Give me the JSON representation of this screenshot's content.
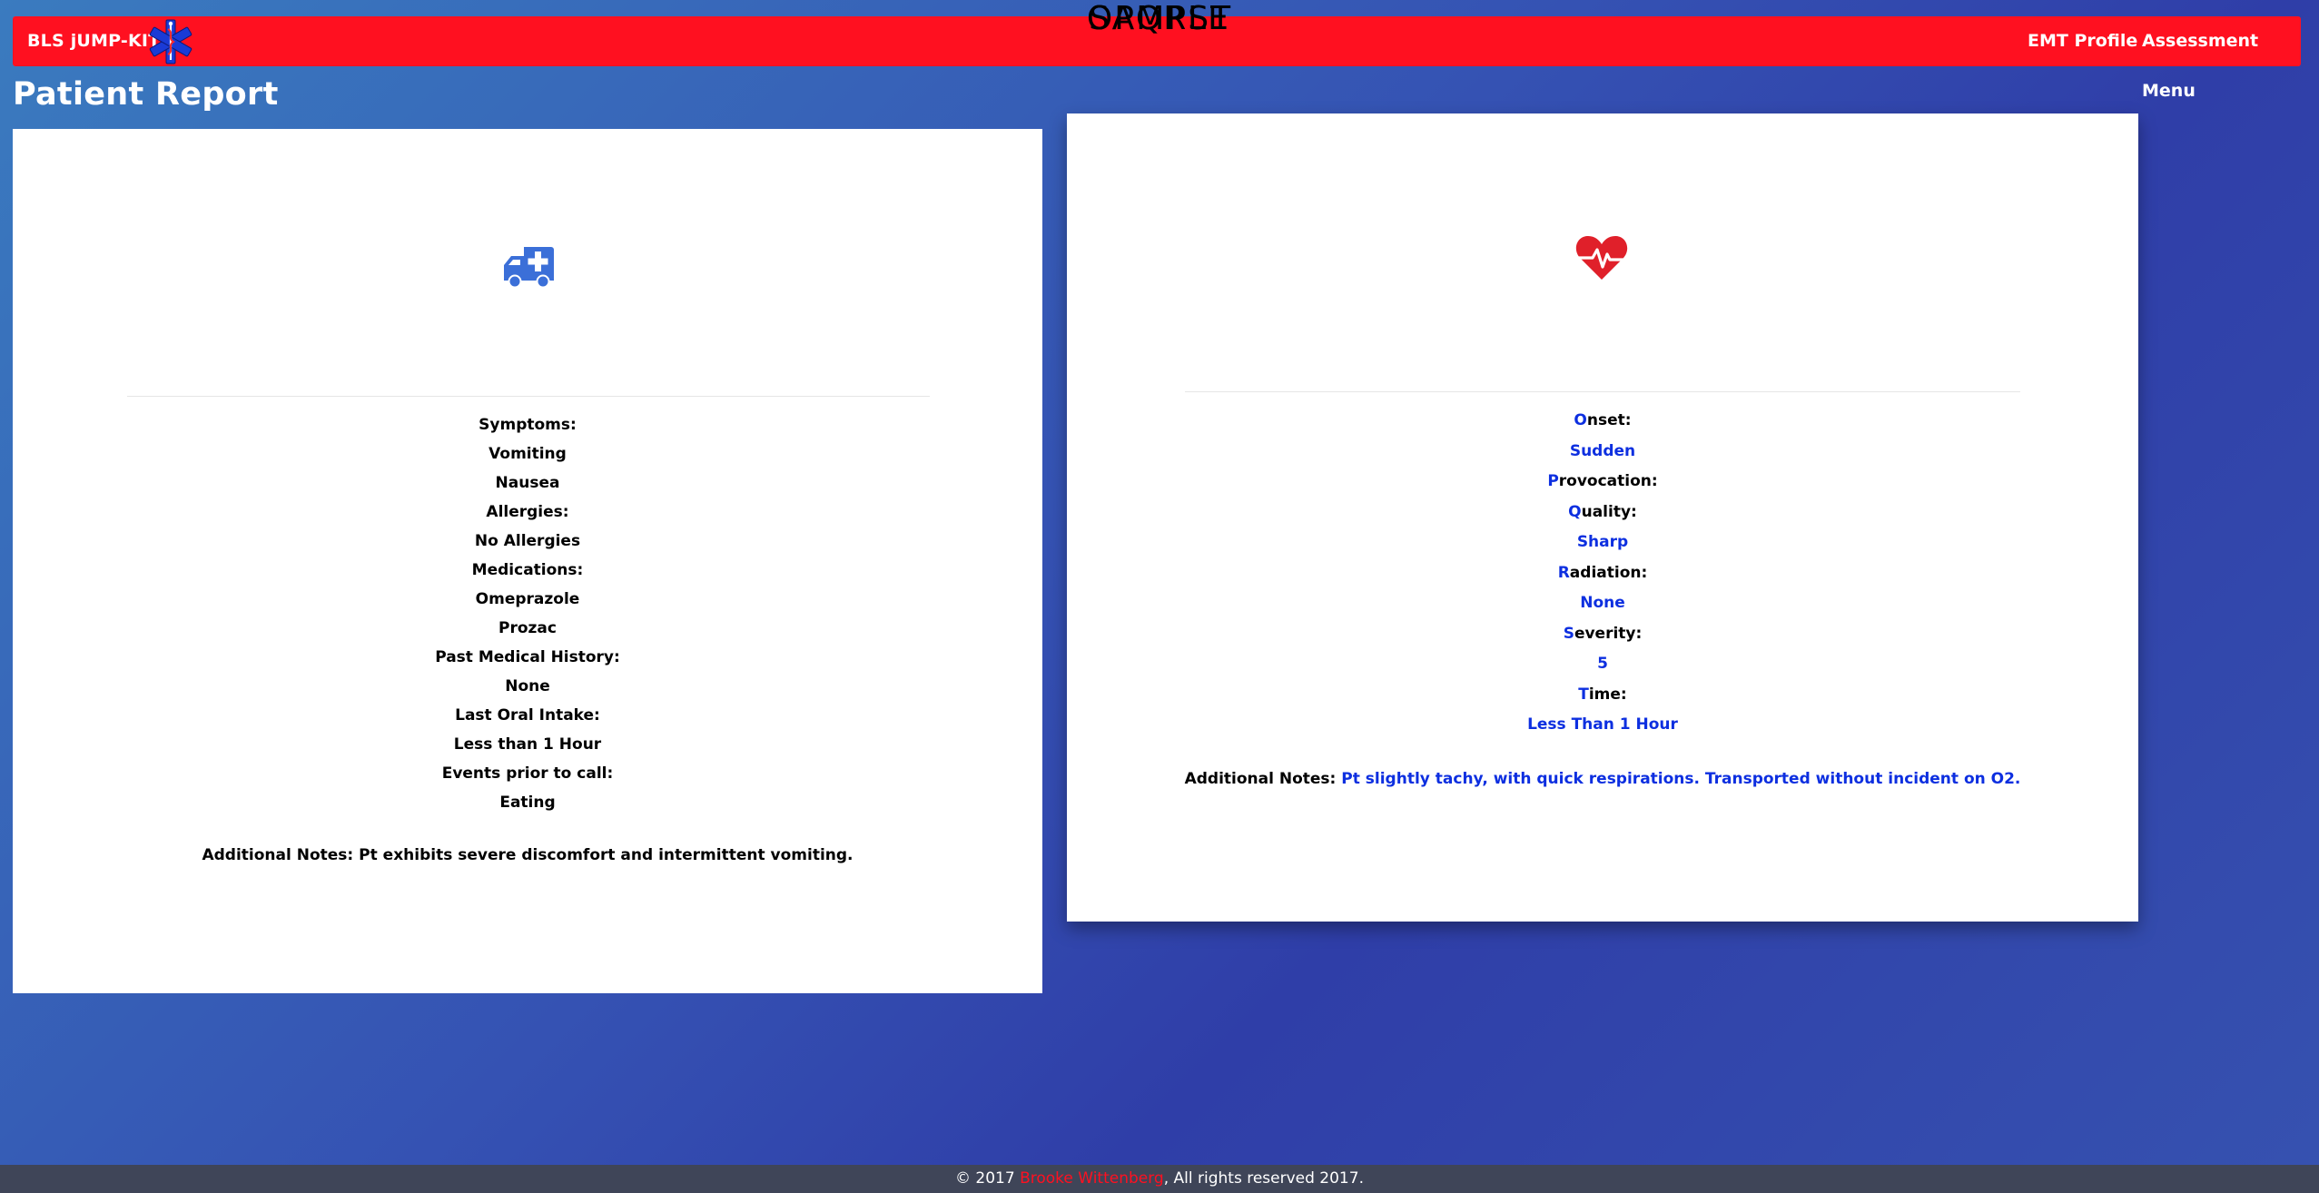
{
  "navbar": {
    "brand": "BLS jUMP-KIT",
    "logo_icon": "star-of-life-icon",
    "links": [
      "EMT Profile",
      "Assessment Menu"
    ],
    "color": "#ff1020"
  },
  "page_title": "Patient Report",
  "sample": {
    "icon": "ambulance-icon",
    "heading": "SAMPLE",
    "rows": [
      "Symptoms:",
      "Vomiting",
      "Nausea",
      "Allergies:",
      "No Allergies",
      "Medications:",
      "Omeprazole",
      "Prozac",
      "Past Medical History:",
      "None",
      "Last Oral Intake:",
      "Less than 1 Hour",
      "Events prior to call:",
      "Eating"
    ],
    "notes_label": "Additional Notes:",
    "notes_value": "Pt exhibits severe discomfort and intermittent vomiting."
  },
  "opqrst": {
    "icon": "heartbeat-icon",
    "heading": "OPQRST",
    "accent_color": "#0d2fe0",
    "icon_color": "#e0202a",
    "onset_letter": "O",
    "onset_rest": "nset:",
    "onset_value": "Sudden",
    "provocation_letter": "P",
    "provocation_rest": "rovocation:",
    "quality_letter": "Q",
    "quality_rest": "uality:",
    "quality_value": "Sharp",
    "radiation_letter": "R",
    "radiation_rest": "adiation:",
    "radiation_value": "None",
    "severity_letter": "S",
    "severity_rest": "everity:",
    "severity_value": "5",
    "time_letter": "T",
    "time_rest": "ime:",
    "time_value": "Less Than 1 Hour",
    "notes_label": "Additional Notes:",
    "notes_value": "Pt slightly tachy, with quick respirations. Transported without incident on O2."
  },
  "footer": {
    "prefix": "© 2017",
    "author": "Brooke Wittenberg",
    "suffix": ", All rights reserved 2017."
  }
}
